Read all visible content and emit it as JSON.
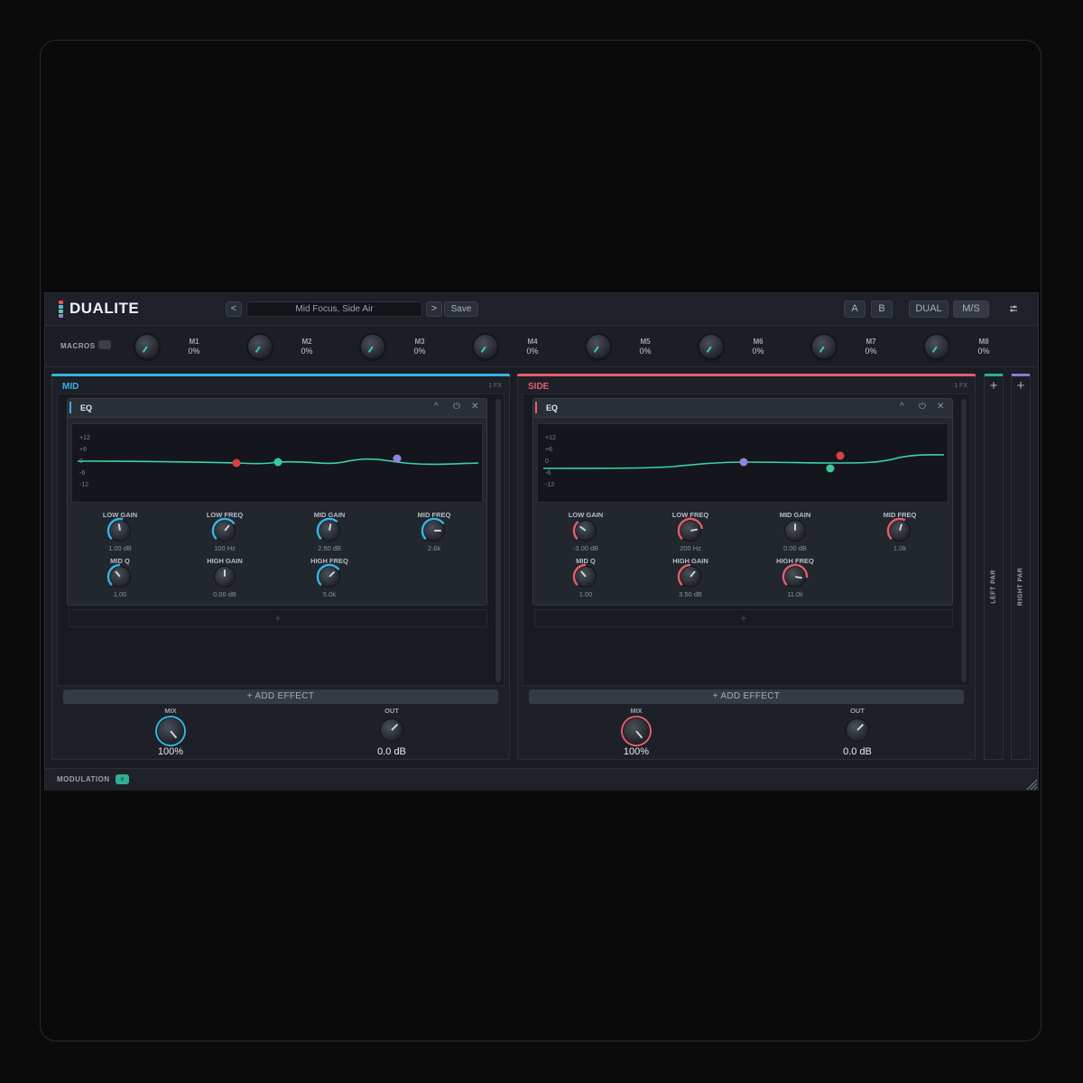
{
  "app": {
    "name": "DUALITE",
    "logo_colors": [
      "#e4574c",
      "#4cc0e0",
      "#5cd19f",
      "#9d7fe8"
    ]
  },
  "header": {
    "prev_label": "<",
    "next_label": ">",
    "preset_name": "Mid Focus, Side Air",
    "save_label": "Save",
    "ab": [
      "A",
      "B"
    ],
    "modes": [
      "DUAL",
      "M/S"
    ],
    "settings_icon": "sliders-icon"
  },
  "macros": {
    "label": "MACROS",
    "items": [
      {
        "name": "M1",
        "value": "0%"
      },
      {
        "name": "M2",
        "value": "0%"
      },
      {
        "name": "M3",
        "value": "0%"
      },
      {
        "name": "M4",
        "value": "0%"
      },
      {
        "name": "M5",
        "value": "0%"
      },
      {
        "name": "M6",
        "value": "0%"
      },
      {
        "name": "M7",
        "value": "0%"
      },
      {
        "name": "M8",
        "value": "0%"
      }
    ]
  },
  "db_labels": [
    "+12",
    "+6",
    "0",
    "-6",
    "-12"
  ],
  "mid": {
    "title": "MID",
    "fx_count": "1 FX",
    "accent": "#35b3e6",
    "effect": {
      "name": "EQ",
      "params": [
        {
          "label": "LOW GAIN",
          "value": "1.00 dB"
        },
        {
          "label": "LOW FREQ",
          "value": "100 Hz"
        },
        {
          "label": "MID GAIN",
          "value": "2.50 dB"
        },
        {
          "label": "MID FREQ",
          "value": "2.6k"
        },
        {
          "label": "MID Q",
          "value": "1.00"
        },
        {
          "label": "HIGH GAIN",
          "value": "0.00 dB"
        },
        {
          "label": "HIGH FREQ",
          "value": "5.0k"
        }
      ]
    },
    "add_effect": "+   ADD EFFECT",
    "mix": {
      "label": "MIX",
      "value": "100%"
    },
    "out": {
      "label": "OUT",
      "value": "0.0 dB"
    }
  },
  "side": {
    "title": "SIDE",
    "fx_count": "1 FX",
    "accent": "#e35d6f",
    "effect": {
      "name": "EQ",
      "params": [
        {
          "label": "LOW GAIN",
          "value": "-3.00 dB"
        },
        {
          "label": "LOW FREQ",
          "value": "200 Hz"
        },
        {
          "label": "MID GAIN",
          "value": "0.00 dB"
        },
        {
          "label": "MID FREQ",
          "value": "1.0k"
        },
        {
          "label": "MID Q",
          "value": "1.00"
        },
        {
          "label": "HIGH GAIN",
          "value": "3.50 dB"
        },
        {
          "label": "HIGH FREQ",
          "value": "11.0k"
        }
      ]
    },
    "add_effect": "+   ADD EFFECT",
    "mix": {
      "label": "MIX",
      "value": "100%"
    },
    "out": {
      "label": "OUT",
      "value": "0.0 dB"
    }
  },
  "left_par": {
    "label": "LEFT PAR",
    "add": "+",
    "accent": "#2fae93"
  },
  "right_par": {
    "label": "RIGHT PAR",
    "add": "+",
    "accent": "#8e77d6"
  },
  "modulation": {
    "label": "MODULATION",
    "toggle": "v"
  }
}
